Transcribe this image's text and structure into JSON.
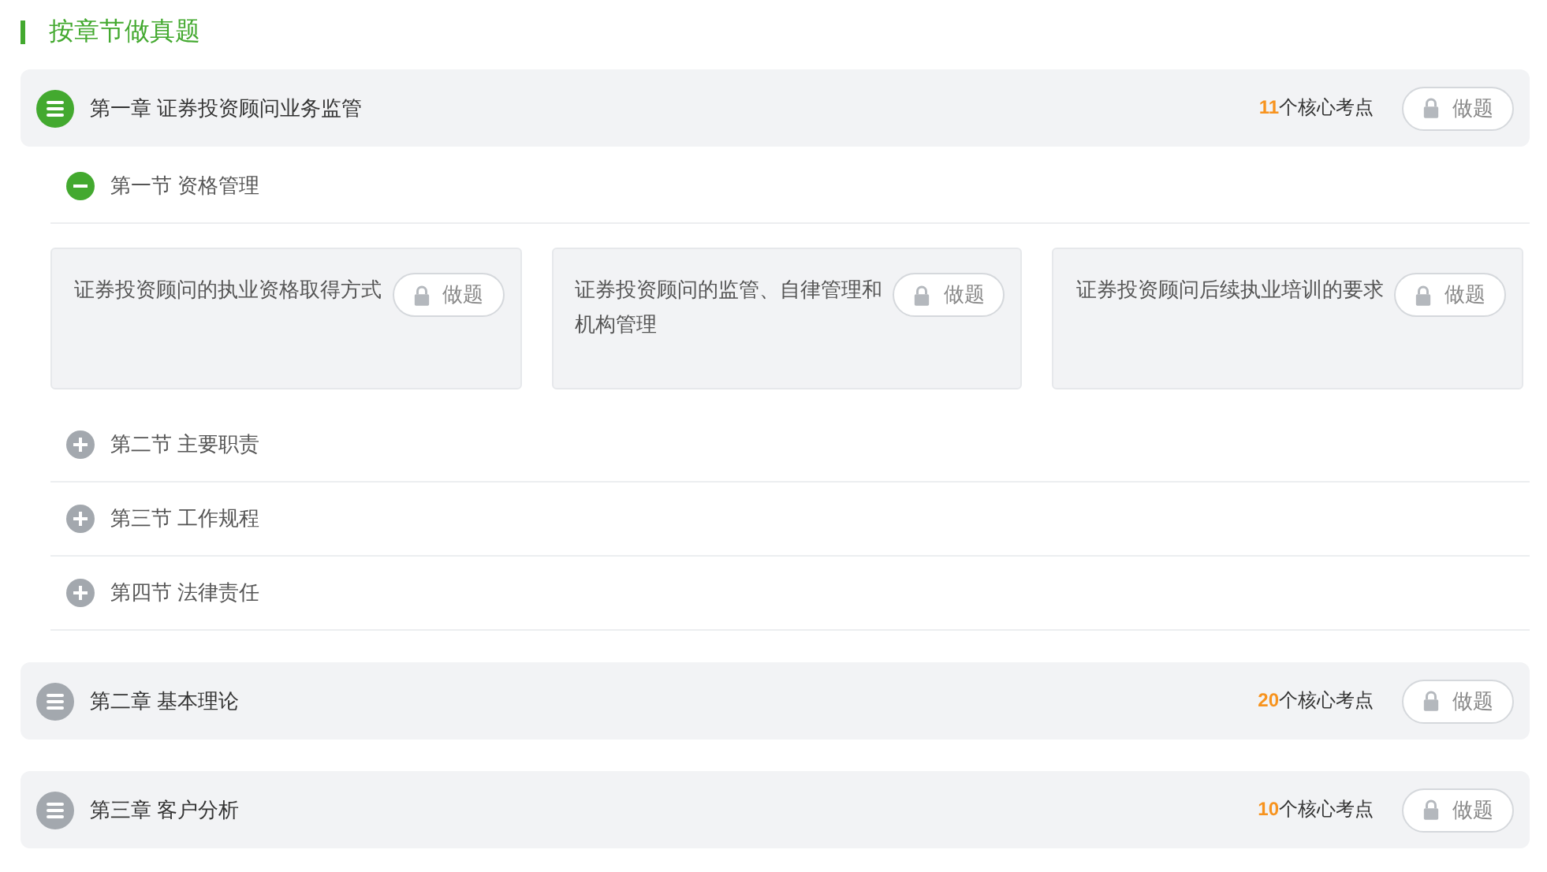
{
  "heading": "按章节做真题",
  "chapters": [
    {
      "title": "第一章 证券投资顾问业务监管",
      "expanded": true,
      "count": "11",
      "count_label": "个核心考点",
      "button": "做题",
      "sections": [
        {
          "title": "第一节 资格管理",
          "expanded": true,
          "topics": [
            {
              "title": "证券投资顾问的执业资格取得方式",
              "button": "做题"
            },
            {
              "title": "证券投资顾问的监管、自律管理和机构管理",
              "button": "做题"
            },
            {
              "title": "证券投资顾问后续执业培训的要求",
              "button": "做题"
            }
          ]
        },
        {
          "title": "第二节 主要职责",
          "expanded": false
        },
        {
          "title": "第三节 工作规程",
          "expanded": false
        },
        {
          "title": "第四节 法律责任",
          "expanded": false
        }
      ]
    },
    {
      "title": "第二章 基本理论",
      "expanded": false,
      "count": "20",
      "count_label": "个核心考点",
      "button": "做题"
    },
    {
      "title": "第三章 客户分析",
      "expanded": false,
      "count": "10",
      "count_label": "个核心考点",
      "button": "做题"
    }
  ]
}
